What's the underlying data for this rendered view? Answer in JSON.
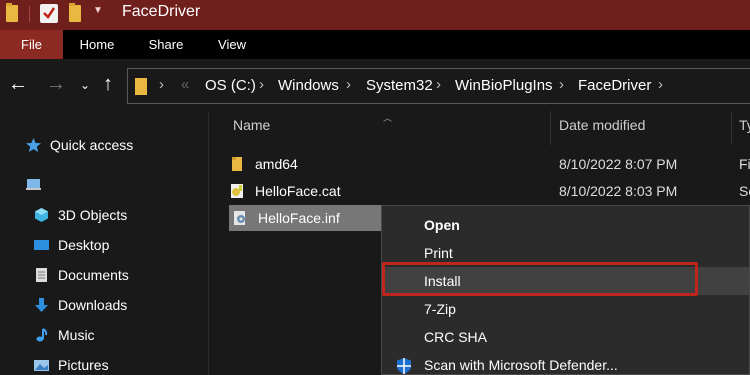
{
  "window": {
    "title": "FaceDriver"
  },
  "ribbon": {
    "tabs": [
      "File",
      "Home",
      "Share",
      "View"
    ]
  },
  "address": {
    "crumbs": [
      "OS (C:)",
      "Windows",
      "System32",
      "WinBioPlugIns",
      "FaceDriver"
    ]
  },
  "sidebar": {
    "items": [
      {
        "label": "Quick access",
        "icon": "star-icon"
      },
      {
        "label": "",
        "icon": "this-pc-icon"
      },
      {
        "label": "3D Objects",
        "icon": "3d-objects-icon"
      },
      {
        "label": "Desktop",
        "icon": "desktop-icon"
      },
      {
        "label": "Documents",
        "icon": "documents-icon"
      },
      {
        "label": "Downloads",
        "icon": "downloads-icon"
      },
      {
        "label": "Music",
        "icon": "music-icon"
      },
      {
        "label": "Pictures",
        "icon": "pictures-icon"
      }
    ]
  },
  "columns": {
    "name": "Name",
    "date_modified": "Date modified",
    "type": "Ty"
  },
  "files": [
    {
      "name": "amd64",
      "date": "8/10/2022 8:07 PM",
      "type": "Fi",
      "icon": "folder-icon"
    },
    {
      "name": "HelloFace.cat",
      "date": "8/10/2022 8:03 PM",
      "type": "Se",
      "icon": "catalog-file-icon"
    },
    {
      "name": "HelloFace.inf",
      "date": "",
      "type": "",
      "icon": "setup-info-file-icon"
    }
  ],
  "context_menu": {
    "items": [
      "Open",
      "Print",
      "Install",
      "7-Zip",
      "CRC SHA",
      "Scan with Microsoft Defender..."
    ]
  },
  "colors": {
    "titlebar": "#6f1f1c",
    "file_tab": "#8b2a22",
    "highlight_outline": "#c0241e",
    "folder": "#e8b841"
  }
}
